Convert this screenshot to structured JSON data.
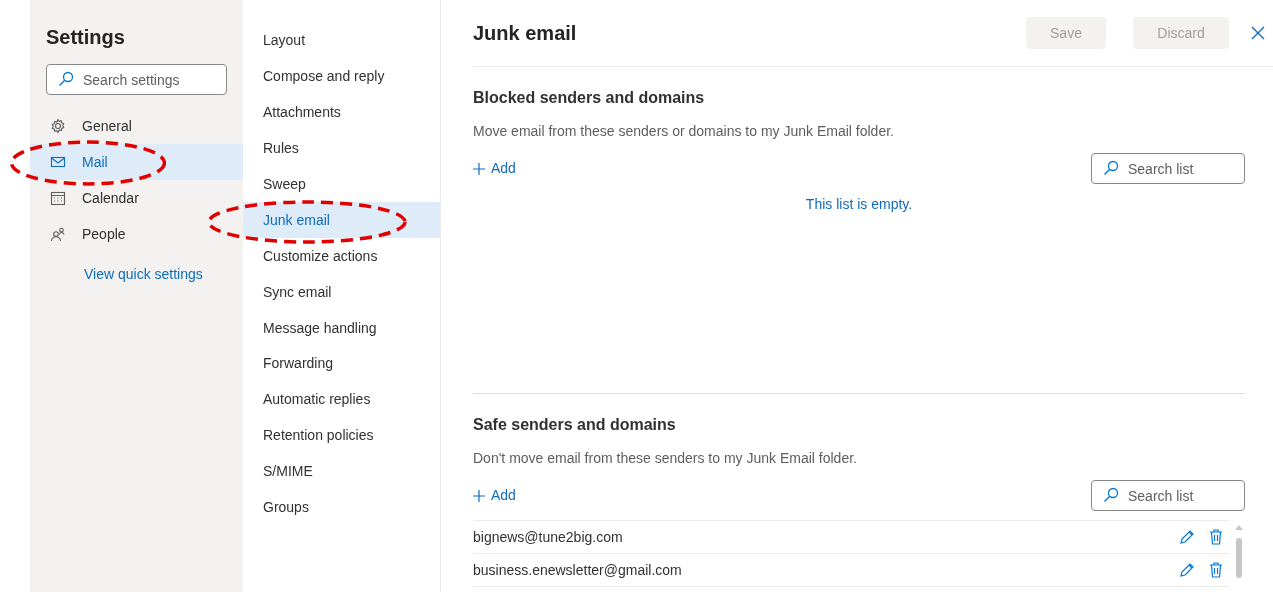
{
  "sidebar": {
    "title": "Settings",
    "search": {
      "placeholder": "Search settings"
    },
    "items": [
      {
        "label": "General",
        "selected": false,
        "circled": false
      },
      {
        "label": "Mail",
        "selected": true,
        "circled": true
      },
      {
        "label": "Calendar",
        "selected": false,
        "circled": false
      },
      {
        "label": "People",
        "selected": false,
        "circled": false
      }
    ],
    "link": "View quick settings"
  },
  "mail_nav": [
    {
      "label": "Layout",
      "selected": false,
      "circled": false
    },
    {
      "label": "Compose and reply",
      "selected": false,
      "circled": false
    },
    {
      "label": "Attachments",
      "selected": false,
      "circled": false
    },
    {
      "label": "Rules",
      "selected": false,
      "circled": false
    },
    {
      "label": "Sweep",
      "selected": false,
      "circled": false
    },
    {
      "label": "Junk email",
      "selected": true,
      "circled": true
    },
    {
      "label": "Customize actions",
      "selected": false,
      "circled": false
    },
    {
      "label": "Sync email",
      "selected": false,
      "circled": false
    },
    {
      "label": "Message handling",
      "selected": false,
      "circled": false
    },
    {
      "label": "Forwarding",
      "selected": false,
      "circled": false
    },
    {
      "label": "Automatic replies",
      "selected": false,
      "circled": false
    },
    {
      "label": "Retention policies",
      "selected": false,
      "circled": false
    },
    {
      "label": "S/MIME",
      "selected": false,
      "circled": false
    },
    {
      "label": "Groups",
      "selected": false,
      "circled": false
    }
  ],
  "page": {
    "title": "Junk email",
    "buttons": [
      {
        "label": "Save",
        "disabled": true
      },
      {
        "label": "Discard",
        "disabled": true
      }
    ],
    "sections": [
      {
        "title": "Blocked senders and domains",
        "description": "Move email from these senders or domains to my Junk Email folder.",
        "add": "Add",
        "search": {
          "placeholder": "Search list"
        },
        "empty_text": "This list is empty."
      },
      {
        "title": "Safe senders and domains",
        "description": "Don't move email from these senders to my Junk Email folder.",
        "add": "Add",
        "search": {
          "placeholder": "Search list"
        },
        "entries": [
          "bignews@tune2big.com",
          "business.enewsletter@gmail.com"
        ]
      }
    ]
  }
}
